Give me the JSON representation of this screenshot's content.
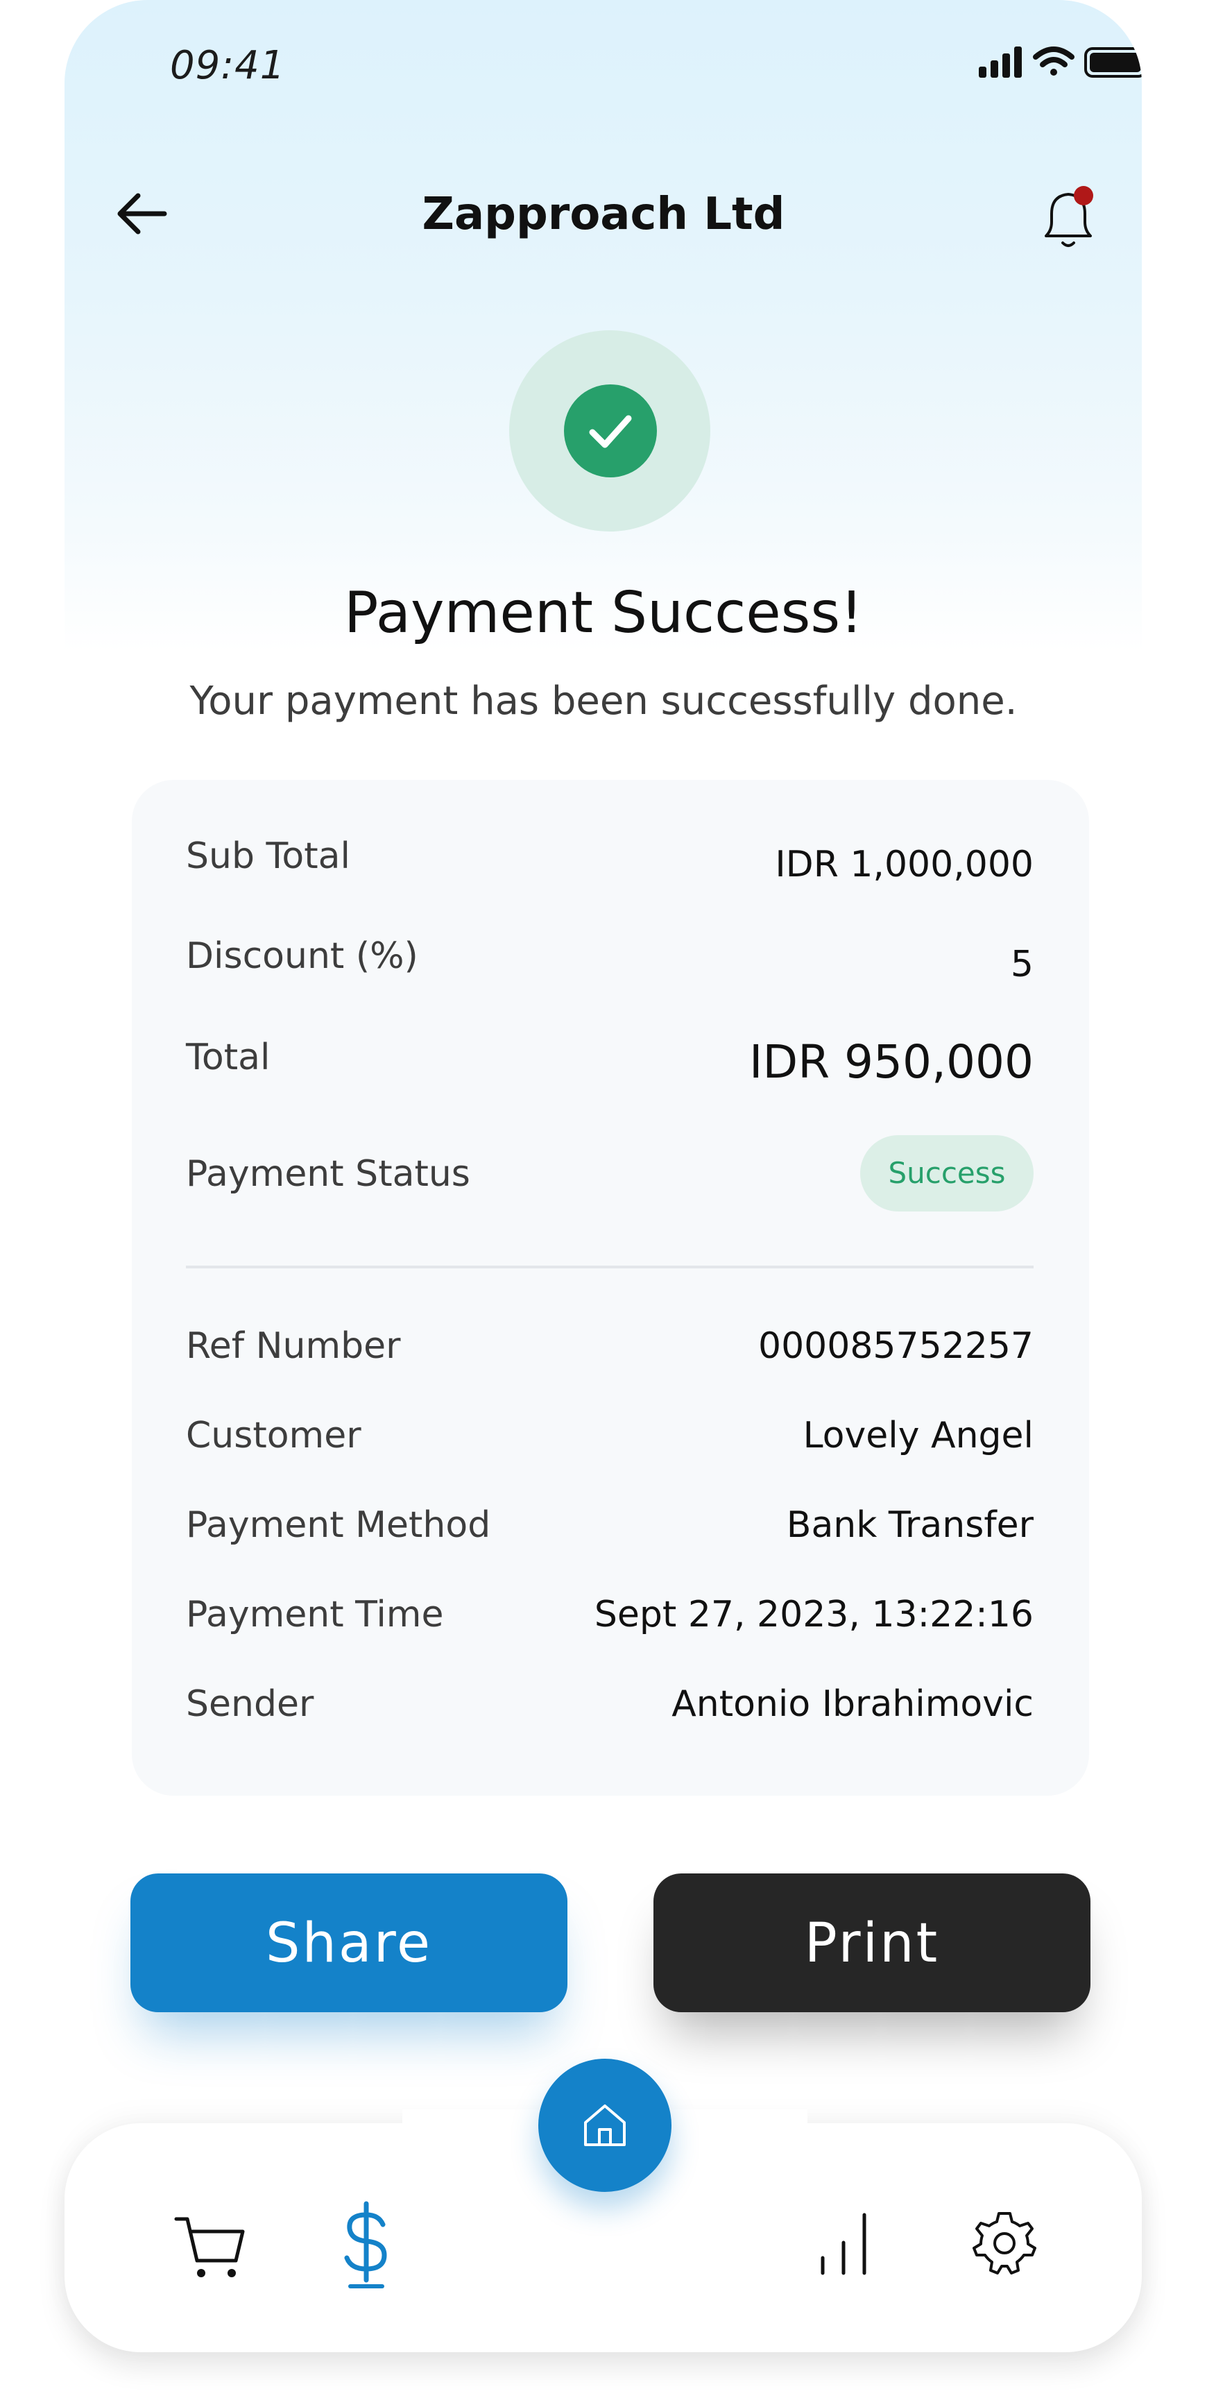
{
  "status_bar": {
    "time": "09:41"
  },
  "header": {
    "title": "Zapproach Ltd",
    "back_icon": "arrow-left-icon",
    "notification_icon": "bell-icon"
  },
  "success": {
    "icon": "check-circle-icon",
    "headline": "Payment Success!",
    "message": "Your payment has been successfully done."
  },
  "summary": {
    "rows": [
      {
        "label": "Sub Total",
        "value": "IDR 1,000,000"
      },
      {
        "label": "Discount (%)",
        "value": "5"
      },
      {
        "label": "Total",
        "value": "IDR 950,000"
      }
    ],
    "status_label": "Payment Status",
    "status_value": "Success"
  },
  "details": {
    "rows": [
      {
        "label": "Ref Number",
        "value": "000085752257"
      },
      {
        "label": "Customer",
        "value": "Lovely Angel"
      },
      {
        "label": "Payment Method",
        "value": "Bank Transfer"
      },
      {
        "label": "Payment Time",
        "value": "Sept 27, 2023, 13:22:16"
      },
      {
        "label": "Sender",
        "value": "Antonio Ibrahimovic"
      }
    ]
  },
  "actions": {
    "share_label": "Share",
    "print_label": "Print"
  },
  "nav": {
    "items": [
      {
        "icon": "cart-icon",
        "active": false
      },
      {
        "icon": "dollar-icon",
        "active": true
      },
      {
        "icon": "home-icon",
        "active": false
      },
      {
        "icon": "bar-chart-icon",
        "active": false
      },
      {
        "icon": "gear-icon",
        "active": false
      }
    ]
  },
  "colors": {
    "accent": "#1482c9",
    "success": "#27a06b",
    "success_bg": "#dcefe7",
    "notification_dot": "#b01818",
    "print_button": "#262626"
  }
}
